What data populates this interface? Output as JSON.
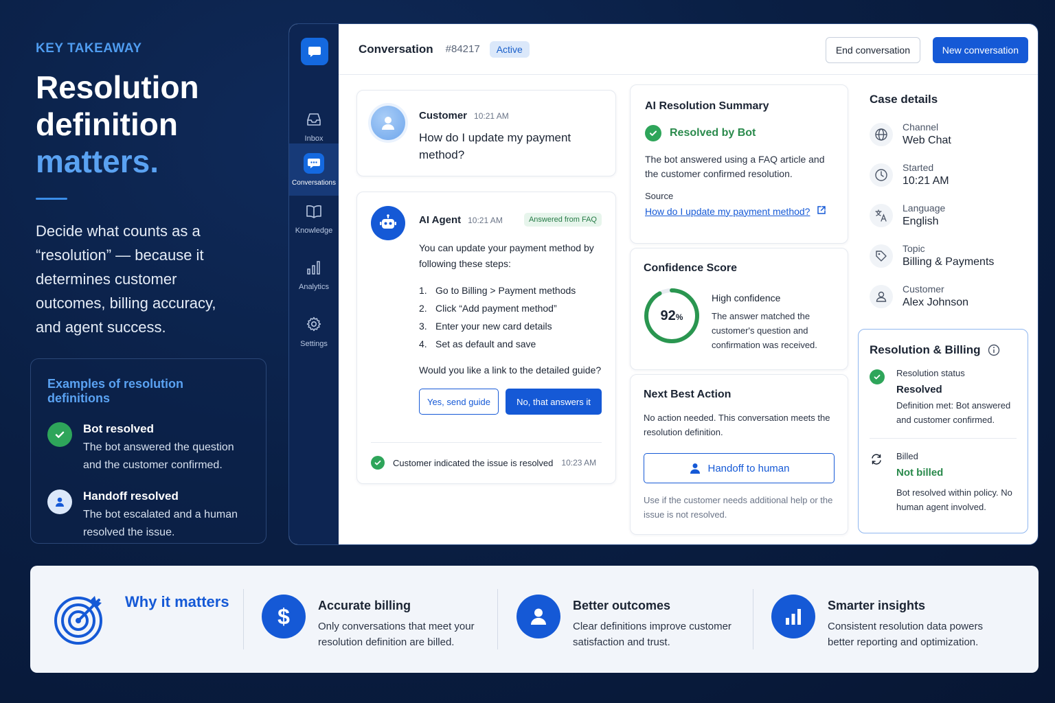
{
  "left": {
    "eyebrow": "KEY TAKEAWAY",
    "headline_line1": "Resolution",
    "headline_line2": "definition",
    "headline_accent": "matters.",
    "lead": "Decide what counts as a “resolution” — because it determines customer outcomes, billing accuracy, and agent success.",
    "examples": {
      "title": "Examples of resolution definitions",
      "items": [
        {
          "title": "Bot resolved",
          "desc": "The bot answered the question and the customer confirmed.",
          "icon": "check-icon"
        },
        {
          "title": "Handoff resolved",
          "desc": "The bot escalated and a human resolved the issue.",
          "icon": "person-icon"
        }
      ]
    }
  },
  "rail": {
    "items": [
      {
        "label": "Inbox",
        "icon": "inbox-icon"
      },
      {
        "label": "Conversations",
        "icon": "chat-icon",
        "active": true
      },
      {
        "label": "Knowledge",
        "icon": "book-icon"
      },
      {
        "label": "Analytics",
        "icon": "bar-chart-icon"
      },
      {
        "label": "Settings",
        "icon": "gear-icon"
      }
    ]
  },
  "topbar": {
    "title": "Conversation",
    "ticket": "#84217",
    "status": "Active",
    "end_label": "End conversation",
    "new_label": "New conversation"
  },
  "conversation": {
    "customer": {
      "name": "Customer",
      "time": "10:21 AM",
      "text": "How do I update my payment method?"
    },
    "agent": {
      "name": "AI Agent",
      "time": "10:21 AM",
      "badge": "Answered from FAQ",
      "intro": "You can update your payment method by following these steps:",
      "steps": [
        {
          "n": "1.",
          "text": "Go to Billing > Payment methods"
        },
        {
          "n": "2.",
          "text": "Click “Add payment method”"
        },
        {
          "n": "3.",
          "text": "Enter your new card details"
        },
        {
          "n": "4.",
          "text": "Set as default and save"
        }
      ],
      "question": "Would you like a link to the detailed guide?",
      "yes_label": "Yes, send guide",
      "no_label": "No, that answers it"
    },
    "resolved_note": "Customer indicated the issue is resolved",
    "resolved_time": "10:23 AM"
  },
  "summary": {
    "title": "AI Resolution Summary",
    "status": "Resolved by Bot",
    "text": "The bot answered using a FAQ article and the customer confirmed resolution.",
    "source_label": "Source",
    "source_link": "How do I update my payment method?"
  },
  "confidence": {
    "title": "Confidence Score",
    "value": 92,
    "value_text": "92",
    "unit": "%",
    "level": "High confidence",
    "desc": "The answer matched the customer's question and confirmation was received."
  },
  "next_action": {
    "title": "Next Best Action",
    "text": "No action needed. This conversation meets the resolution definition.",
    "button": "Handoff to human",
    "help": "Use if the customer needs additional help or the issue is not resolved."
  },
  "case": {
    "title": "Case details",
    "rows": [
      {
        "label": "Channel",
        "value": "Web Chat",
        "icon": "globe-icon"
      },
      {
        "label": "Started",
        "value": "10:21 AM",
        "icon": "clock-icon"
      },
      {
        "label": "Language",
        "value": "English",
        "icon": "translate-icon"
      },
      {
        "label": "Topic",
        "value": "Billing & Payments",
        "icon": "tag-icon"
      },
      {
        "label": "Customer",
        "value": "Alex Johnson",
        "icon": "person-icon"
      }
    ]
  },
  "res_billing": {
    "title": "Resolution & Billing",
    "status_label": "Resolution status",
    "status_value": "Resolved",
    "status_desc": "Definition met: Bot answered and customer confirmed.",
    "billed_label": "Billed",
    "billed_value": "Not billed",
    "billed_desc": "Bot resolved within policy. No human agent involved."
  },
  "bottom": {
    "why_title": "Why it matters",
    "features": [
      {
        "title": "Accurate billing",
        "desc": "Only conversations that meet your resolution definition are billed.",
        "icon": "dollar-icon"
      },
      {
        "title": "Better outcomes",
        "desc": "Clear definitions improve customer satisfaction and trust.",
        "icon": "person-icon"
      },
      {
        "title": "Smarter insights",
        "desc": "Consistent resolution data powers better reporting and optimization.",
        "icon": "bar-chart-icon"
      }
    ]
  },
  "colors": {
    "brand": "#1559d6",
    "accent": "#5aa2f2",
    "success": "#2ea55a",
    "background": "#0a1f44"
  }
}
